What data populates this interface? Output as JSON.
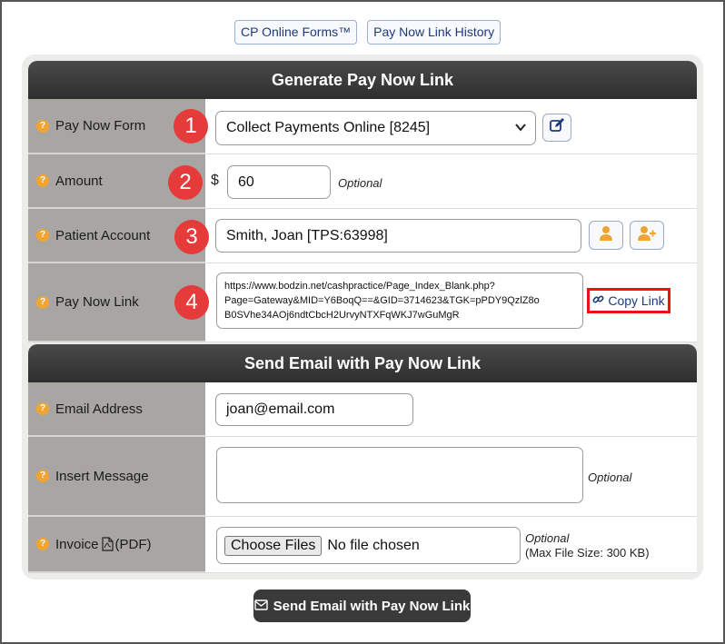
{
  "top_links": [
    {
      "label": "CP Online Forms™"
    },
    {
      "label": "Pay Now Link History"
    }
  ],
  "generate_section": {
    "title": "Generate Pay Now Link",
    "help_glyph": "?",
    "rows": {
      "form": {
        "label": "Pay Now Form",
        "badge": "1",
        "select_value": "Collect Payments Online [8245]"
      },
      "amount": {
        "label": "Amount",
        "badge": "2",
        "currency": "$",
        "value": "60",
        "optional": "Optional"
      },
      "patient": {
        "label": "Patient Account",
        "badge": "3",
        "value": "Smith, Joan [TPS:63998]"
      },
      "link": {
        "label": "Pay Now Link",
        "badge": "4",
        "line1": "https://www.bodzin.net/cashpractice/Page_Index_Blank.php?",
        "line2": "Page=Gateway&MID=Y6BoqQ==&GID=3714623&TGK=pPDY9QzlZ8o",
        "line3": "B0SVhe34AOj6ndtCbcH2UrvyNTXFqWKJ7wGuMgR",
        "copy_label": "Copy Link"
      }
    }
  },
  "email_section": {
    "title": "Send Email with Pay Now Link",
    "rows": {
      "email": {
        "label": "Email Address",
        "value": "joan@email.com"
      },
      "message": {
        "label": "Insert Message",
        "value": "",
        "optional": "Optional"
      },
      "invoice": {
        "label_prefix": "Invoice",
        "label_suffix": "(PDF)",
        "choose_label": "Choose Files",
        "no_file": "No file chosen",
        "optional": "Optional",
        "max_size": "(Max File Size: 300 KB)"
      }
    },
    "send_label": "Send Email with Pay Now Link"
  },
  "colors": {
    "accent_red": "#e63b3b",
    "help_orange": "#f0a532",
    "header_dark": "#3a3a3a",
    "label_gray": "#a8a6a3"
  }
}
